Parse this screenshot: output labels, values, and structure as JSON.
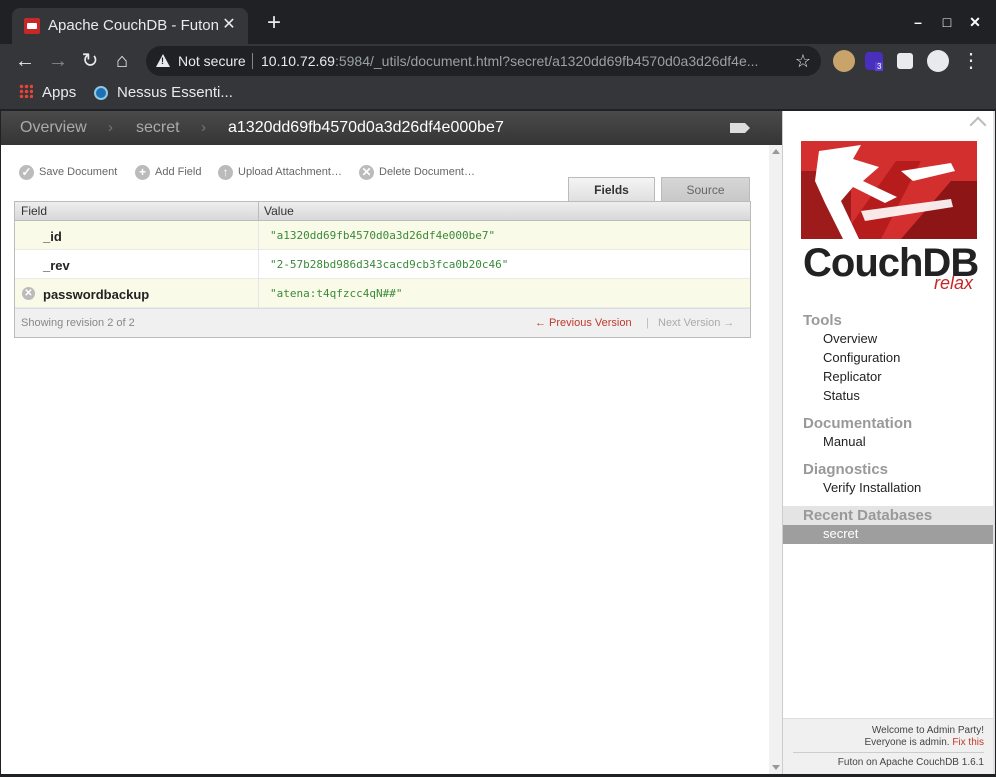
{
  "browser": {
    "tab_title": "Apache CouchDB - Futon: D",
    "tab_close": "✕",
    "new_tab": "+",
    "window_controls": {
      "minimize": "–",
      "maximize": "□",
      "close": "✕"
    },
    "nav": {
      "back": "←",
      "forward": "→",
      "reload": "↻",
      "home": "⌂"
    },
    "security_label": "Not secure",
    "url_host": "10.10.72.69",
    "url_rest": ":5984/_utils/document.html?secret/a1320dd69fb4570d0a3d26df4e...",
    "bookmark_star": "☆",
    "extension_badge": "3",
    "extension_icons": [
      "cookie-extension-icon",
      "shield-extension-icon",
      "puzzle-extensions-icon",
      "profile-avatar-icon",
      "kebab-menu-icon"
    ],
    "bookmarks": [
      {
        "label": "Apps",
        "icon": "apps-grid-icon"
      },
      {
        "label": "Nessus Essenti...",
        "icon": "nessus-icon"
      }
    ]
  },
  "breadcrumb": {
    "items": [
      "Overview",
      "secret",
      "a1320dd69fb4570d0a3d26df4e000be7"
    ],
    "separator": "›"
  },
  "actions": [
    {
      "label": "Save Document",
      "icon": "check-icon"
    },
    {
      "label": "Add Field",
      "icon": "plus-icon"
    },
    {
      "label": "Upload Attachment…",
      "icon": "upload-icon"
    },
    {
      "label": "Delete Document…",
      "icon": "delete-icon"
    }
  ],
  "view_tabs": {
    "fields": "Fields",
    "source": "Source",
    "active": "fields"
  },
  "table": {
    "headers": {
      "field": "Field",
      "value": "Value"
    },
    "rows": [
      {
        "field": "_id",
        "value": "\"a1320dd69fb4570d0a3d26df4e000be7\"",
        "deletable": false
      },
      {
        "field": "_rev",
        "value": "\"2-57b28bd986d343cacd9cb3fca0b20c46\"",
        "deletable": false
      },
      {
        "field": "passwordbackup",
        "value": "\"atena:t4qfzcc4qN##\"",
        "deletable": true
      }
    ],
    "footer": {
      "revision_info": "Showing revision 2 of 2",
      "previous": "← Previous Version",
      "separator": "|",
      "next": "Next Version →"
    }
  },
  "sidebar": {
    "logo_text": "CouchDB",
    "logo_tagline": "relax",
    "sections": [
      {
        "title": "Tools",
        "items": [
          "Overview",
          "Configuration",
          "Replicator",
          "Status"
        ]
      },
      {
        "title": "Documentation",
        "items": [
          "Manual"
        ]
      },
      {
        "title": "Diagnostics",
        "items": [
          "Verify Installation"
        ]
      },
      {
        "title": "Recent Databases",
        "items": [
          "secret"
        ]
      }
    ],
    "footer": {
      "welcome": "Welcome to Admin Party!",
      "everyone": "Everyone is admin.",
      "fix": "Fix this",
      "version": "Futon on Apache CouchDB 1.6.1"
    }
  },
  "colors": {
    "accent_red": "#c62828",
    "value_green": "#3a8a3a",
    "link_red": "#c0392b"
  }
}
